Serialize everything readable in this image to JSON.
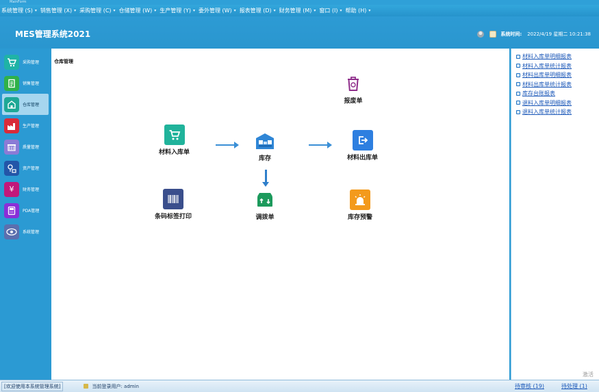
{
  "window": {
    "title": "MainForm"
  },
  "menu": [
    {
      "label": "系统管理 (S)"
    },
    {
      "label": "销售管理 (X)"
    },
    {
      "label": "采购管理 (C)"
    },
    {
      "label": "仓储管理 (W)"
    },
    {
      "label": "生产管理 (Y)"
    },
    {
      "label": "委外管理 (W)"
    },
    {
      "label": "报表管理 (D)"
    },
    {
      "label": "财务管理 (M)"
    },
    {
      "label": "窗口 (I)"
    },
    {
      "label": "帮助 (H)"
    }
  ],
  "header": {
    "app_title": "MES管理系统2021",
    "datetime_label": "系统时间:",
    "datetime": "2022/4/19 星期二 10:21:38"
  },
  "sidebar": [
    {
      "label": "采购管理",
      "icon": "cart-icon",
      "color": "#1fb3a6"
    },
    {
      "label": "销售管理",
      "icon": "document-icon",
      "color": "#2fb14a"
    },
    {
      "label": "仓库管理",
      "icon": "warehouse-icon",
      "color": "#1ea896",
      "active": true
    },
    {
      "label": "生产管理",
      "icon": "factory-icon",
      "color": "#d92b3a"
    },
    {
      "label": "质量管理",
      "icon": "shop-icon",
      "color": "#8b7bd6"
    },
    {
      "label": "资产管理",
      "icon": "asset-icon",
      "color": "#2356a8"
    },
    {
      "label": "财务管理",
      "icon": "yen-icon",
      "color": "#c2187a"
    },
    {
      "label": "PDA管理",
      "icon": "pda-icon",
      "color": "#8a2fd8"
    },
    {
      "label": "系统管理",
      "icon": "gear-eye-icon",
      "color": "#5b6fae"
    }
  ],
  "content": {
    "section_title": "仓库管理",
    "nodes": {
      "scrap": "报废单",
      "material_in": "材料入库单",
      "stock": "库存",
      "material_out": "材料出库单",
      "barcode": "条码标签打印",
      "transfer": "调拨单",
      "alert": "库存预警"
    },
    "colors": {
      "scrap": "#8e2c8a",
      "material_in": "#20b39b",
      "stock": "#2f86d6",
      "material_out": "#2e7fe0",
      "barcode": "#3a4e8c",
      "transfer": "#1c9a5c",
      "alert": "#f39a1c"
    }
  },
  "reports": [
    "材料入库单明细报表",
    "材料入库单统计报表",
    "材料出库单明细报表",
    "材料出库单统计报表",
    "库存台账报表",
    "退料入库单明细报表",
    "退料入库单统计报表"
  ],
  "watermark": "激活",
  "status": {
    "company": "[欢迎使用本系统管理系统]",
    "user": "当前登录用户: admin",
    "pending_review": "待审核 (19)",
    "pending_process": "待处理 (1)"
  }
}
